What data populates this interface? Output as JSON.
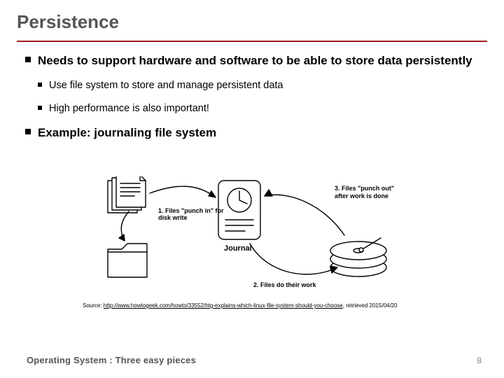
{
  "title": "Persistence",
  "bullets": {
    "b1a": "Needs to support hardware and software to be able to store data persistently",
    "b2a": "Use file system to store and manage persistent data",
    "b2b": "High performance is also important!",
    "b1b": "Example: journaling file system"
  },
  "diagram": {
    "note1": "1. Files \"punch in\" for disk write",
    "note2": "2. Files do their work",
    "note3a": "3. Files \"punch out\"",
    "note3b": "after work is done",
    "journal": "Journal"
  },
  "source": {
    "prefix": "Source: ",
    "url": "http://www.howtogeek.com/howto/33552/htg-explains-which-linux-file-system-should-you-choose",
    "suffix": ", retrieved 2015/04/20"
  },
  "footer": {
    "left": "Operating System : Three easy pieces",
    "page": "8"
  }
}
